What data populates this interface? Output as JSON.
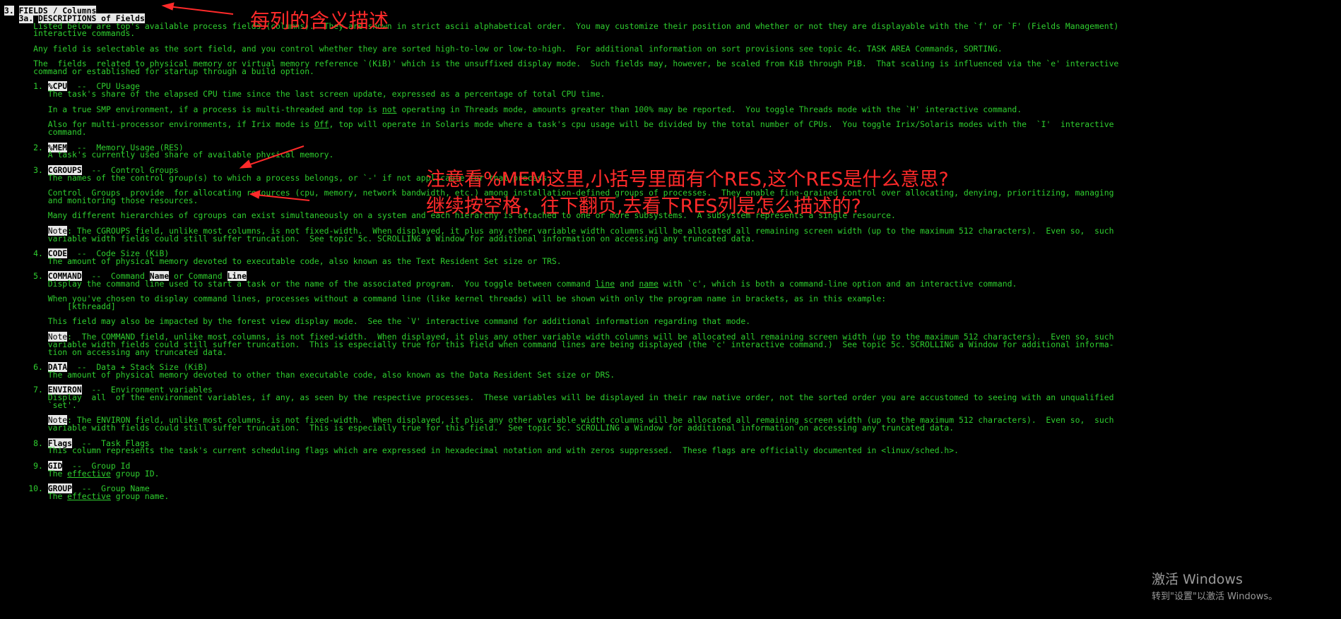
{
  "terminal": {
    "section_num": "3.",
    "section_title": "FIELDS / Columns",
    "subsection_num": "3a.",
    "subsection_title": "DESCRIPTIONS of Fields",
    "intro1a": "Listed below are top's available process fields (columns).  They are shown in strict ascii alphabetical order.  You may customize their position and whether or not they are displayable with the `f' or `F' (Fields Management)",
    "intro1b": "interactive commands.",
    "intro2": "Any field is selectable as the sort field, and you control whether they are sorted high-to-low or low-to-high.  For additional information on sort provisions see topic 4c. TASK AREA Commands, SORTING.",
    "intro3a": "The  fields  related to physical memory or virtual memory reference `(KiB)' which is the unsuffixed display mode.  Such fields may, however, be scaled from KiB through PiB.  That scaling is influenced via the `e' interactive",
    "intro3b": "command or established for startup through a build option.",
    "f1_num": "1.",
    "f1_name": "%CPU",
    "f1_title": "  --  CPU Usage",
    "f1_d1": "The task's share of the elapsed CPU time since the last screen update, expressed as a percentage of total CPU time.",
    "f1_d2a": "In a true SMP environment, if a process is multi-threaded and top is ",
    "f1_d2b": "not",
    "f1_d2c": " operating in Threads mode, amounts greater than 100% may be reported.  You toggle Threads mode with the `H' interactive command.",
    "f1_d3a": "Also for multi-processor environments, if Irix mode is ",
    "f1_d3b": "Off",
    "f1_d3c": ", top will operate in Solaris mode where a task's cpu usage will be divided by the total number of CPUs.  You toggle Irix/Solaris modes with the  `I'  interactive",
    "f1_d3d": "command.",
    "f2_num": "2.",
    "f2_name": "%MEM",
    "f2_title": "  --  Memory Usage (RES)",
    "f2_d1": "A task's currently used share of available physical memory.",
    "f3_num": "3.",
    "f3_name": "CGROUPS",
    "f3_title": "  --  Control Groups",
    "f3_d1": "The names of the control group(s) to which a process belongs, or `-' if not applicable for that process.",
    "f3_d2a": "Control  Groups  provide  for allocating resources (cpu, memory, network bandwidth, etc.) among installation-defined groups of processes.  They enable fine-grained control over allocating, denying, prioritizing, managing",
    "f3_d2b": "and monitoring those resources.",
    "f3_d3": "Many different hierarchies of cgroups can exist simultaneously on a system and each hierarchy is attached to one or more subsystems.  A subsystem represents a single resource.",
    "f3_note": "Note",
    "f3_d4a": ": The CGROUPS field, unlike most columns, is not fixed-width.  When displayed, it plus any other variable width columns will be allocated all remaining screen width (up to the maximum 512 characters).  Even so,  such",
    "f3_d4b": "variable width fields could still suffer truncation.  See topic 5c. SCROLLING a Window for additional information on accessing any truncated data.",
    "f4_num": "4.",
    "f4_name": "CODE",
    "f4_title": "  --  Code Size (KiB)",
    "f4_d1": "The amount of physical memory devoted to executable code, also known as the Text Resident Set size or TRS.",
    "f5_num": "5.",
    "f5_name": "COMMAND",
    "f5_title_a": "  --  Command ",
    "f5_title_b": "Name",
    "f5_title_c": " or Command ",
    "f5_title_d": "Line",
    "f5_d1a": "Display the command line used to start a task or the name of the associated program.  You toggle between command ",
    "f5_d1b": "line",
    "f5_d1c": " and ",
    "f5_d1d": "name",
    "f5_d1e": " with `c', which is both a command-line option and an interactive command.",
    "f5_d2": "When you've chosen to display command lines, processes without a command line (like kernel threads) will be shown with only the program name in brackets, as in this example:",
    "f5_d2b": "    [kthreadd]",
    "f5_d3": "This field may also be impacted by the forest view display mode.  See the `V' interactive command for additional information regarding that mode.",
    "f5_note": "Note",
    "f5_d4a": ":  The COMMAND field, unlike most columns, is not fixed-width.  When displayed, it plus any other variable width columns will be allocated all remaining screen width (up to the maximum 512 characters).  Even so, such",
    "f5_d4b": "variable width fields could still suffer truncation.  This is especially true for this field when command lines are being displayed (the `c' interactive command.)  See topic 5c. SCROLLING a Window for additional informa-",
    "f5_d4c": "tion on accessing any truncated data.",
    "f6_num": "6.",
    "f6_name": "DATA",
    "f6_title": "  --  Data + Stack Size (KiB)",
    "f6_d1": "The amount of physical memory devoted to other than executable code, also known as the Data Resident Set size or DRS.",
    "f7_num": "7.",
    "f7_name": "ENVIRON",
    "f7_title": "  --  Environment variables",
    "f7_d1a": "Display  all  of the environment variables, if any, as seen by the respective processes.  These variables will be displayed in their raw native order, not the sorted order you are accustomed to seeing with an unqualified",
    "f7_d1b": "`set'.",
    "f7_note": "Note",
    "f7_d2a": ": The ENVIRON field, unlike most columns, is not fixed-width.  When displayed, it plus any other variable width columns will be allocated all remaining screen width (up to the maximum 512 characters).  Even so,  such",
    "f7_d2b": "variable width fields could still suffer truncation.  This is especially true for this field.  See topic 5c. SCROLLING a Window for additional information on accessing any truncated data.",
    "f8_num": "8.",
    "f8_name": "Flags",
    "f8_title": "  --  Task Flags",
    "f8_d1": "This column represents the task's current scheduling flags which are expressed in hexadecimal notation and with zeros suppressed.  These flags are officially documented in <linux/sched.h>.",
    "f9_num": "9.",
    "f9_name": "GID",
    "f9_title": "  --  Group Id",
    "f9_d1a": "The ",
    "f9_d1b": "effective",
    "f9_d1c": " group ID.",
    "f10_num": "10.",
    "f10_name": "GROUP",
    "f10_title": "  --  Group Name",
    "f10_d1a": "The ",
    "f10_d1b": "effective",
    "f10_d1c": " group name."
  },
  "annotations": {
    "note1": "每列的含义描述",
    "note2_line1": "注意看%MEM这里,小括号里面有个RES,这个RES是什么意思?",
    "note2_line2": "继续按空格，往下翻页,去看下RES列是怎么描述的?",
    "color": "#ff2a2a"
  },
  "watermark": {
    "title": "激活 Windows",
    "subtitle": "转到\"设置\"以激活 Windows。"
  }
}
